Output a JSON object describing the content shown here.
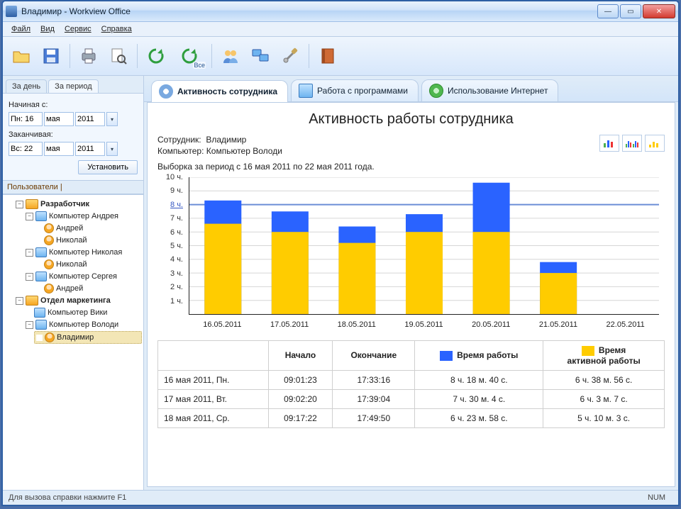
{
  "window": {
    "title": "Владимир - Workview Office"
  },
  "menu": {
    "file": "Файл",
    "view": "Вид",
    "service": "Сервис",
    "help": "Справка"
  },
  "toolbar_icons": {
    "open": "folder-open-icon",
    "save": "save-icon",
    "print": "print-icon",
    "print_preview": "print-preview-icon",
    "refresh": "refresh-icon",
    "refresh_all": "refresh-all-icon",
    "refresh_all_label": "Все",
    "users": "users-icon",
    "computers": "computers-icon",
    "settings": "settings-icon",
    "reports": "reports-icon"
  },
  "left": {
    "tabs": {
      "day": "За день",
      "period": "За период"
    },
    "from_label": "Начиная с:",
    "to_label": "Заканчивая:",
    "from": {
      "dow": "Пн: 16",
      "mon": "мая",
      "year": "2011"
    },
    "to": {
      "dow": "Вс: 22",
      "mon": "мая",
      "year": "2011"
    },
    "apply": "Установить",
    "tree_tab": "Пользователи",
    "tree": {
      "dev": "Разработчик",
      "pc_andrey": "Компьютер Андрея",
      "andrey": "Андрей",
      "nikolay": "Николай",
      "pc_nikolay": "Компьютер Николая",
      "pc_sergey": "Компьютер Сергея",
      "marketing": "Отдел маркетинга",
      "pc_viki": "Компьютер Вики",
      "pc_volodi": "Компьютер Володи",
      "vladimir": "Владимир"
    }
  },
  "bigtabs": {
    "activity": "Активность сотрудника",
    "programs": "Работа с программами",
    "internet": "Использование Интернет"
  },
  "report": {
    "title": "Активность работы сотрудника",
    "employee_label": "Сотрудник:",
    "employee_value": "Владимир",
    "computer_label": "Компьютер:",
    "computer_value": "Компьютер Володи",
    "selection": "Выборка за период с 16 мая 2011 по 22 мая 2011 года."
  },
  "table": {
    "h_start": "Начало",
    "h_end": "Окончание",
    "h_work": "Время работы",
    "h_active": "Время\nактивной работы",
    "rows": [
      {
        "date": "16 мая 2011, Пн.",
        "start": "09:01:23",
        "end": "17:33:16",
        "work": "8 ч. 18 м. 40 с.",
        "active": "6 ч. 38 м. 56 с."
      },
      {
        "date": "17 мая 2011, Вт.",
        "start": "09:02:20",
        "end": "17:39:04",
        "work": "7 ч. 30 м.  4 с.",
        "active": "6 ч.  3 м.  7 с."
      },
      {
        "date": "18 мая 2011, Ср.",
        "start": "09:17:22",
        "end": "17:49:50",
        "work": "6 ч. 23 м. 58 с.",
        "active": "5 ч. 10 м.  3 с."
      }
    ]
  },
  "chart_data": {
    "type": "bar",
    "title": "Активность работы сотрудника",
    "ylabel": "ч.",
    "ylim": [
      0,
      10
    ],
    "yticks": [
      1,
      2,
      3,
      4,
      5,
      6,
      7,
      8,
      9,
      10
    ],
    "reference_line": 8,
    "categories": [
      "16.05.2011",
      "17.05.2011",
      "18.05.2011",
      "19.05.2011",
      "20.05.2011",
      "21.05.2011",
      "22.05.2011"
    ],
    "series": [
      {
        "name": "Время работы",
        "color": "#2a63ff",
        "values": [
          8.3,
          7.5,
          6.4,
          7.3,
          9.6,
          3.8,
          0
        ]
      },
      {
        "name": "Время активной работы",
        "color": "#ffcc00",
        "values": [
          6.6,
          6.0,
          5.2,
          6.0,
          6.0,
          3.0,
          0
        ]
      }
    ]
  },
  "status": {
    "hint": "Для вызова справки нажмите F1",
    "num": "NUM"
  }
}
